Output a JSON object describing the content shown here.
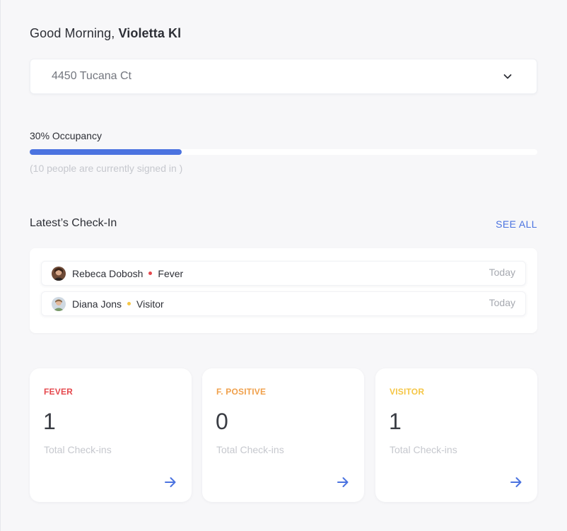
{
  "greeting": {
    "prefix": "Good Morning, ",
    "name": "Violetta Kl"
  },
  "location": {
    "selected": "4450 Tucana Ct",
    "icon": "chevron-down-icon"
  },
  "occupancy": {
    "label": "30% Occupancy",
    "percent": 30,
    "note": "(10 people are currently signed in )",
    "color": "#4b73e0"
  },
  "checkins": {
    "title": "Latest’s Check-In",
    "see_all": "SEE ALL",
    "items": [
      {
        "name": "Rebeca Dobosh",
        "status": "Fever",
        "status_color": "#e5484d",
        "time": "Today",
        "avatar": "avatar-rebeca"
      },
      {
        "name": "Diana Jons",
        "status": "Visitor",
        "status_color": "#f5c646",
        "time": "Today",
        "avatar": "avatar-diana"
      }
    ]
  },
  "stats": [
    {
      "label": "FEVER",
      "color": "#e5484d",
      "count": "1",
      "caption": "Total Check-ins",
      "icon": "arrow-right-icon"
    },
    {
      "label": "F. POSITIVE",
      "color": "#f0a04b",
      "count": "0",
      "caption": "Total Check-ins",
      "icon": "arrow-right-icon"
    },
    {
      "label": "VISITOR",
      "color": "#f5c646",
      "count": "1",
      "caption": "Total Check-ins",
      "icon": "arrow-right-icon"
    }
  ],
  "accent_color": "#4b73e0"
}
